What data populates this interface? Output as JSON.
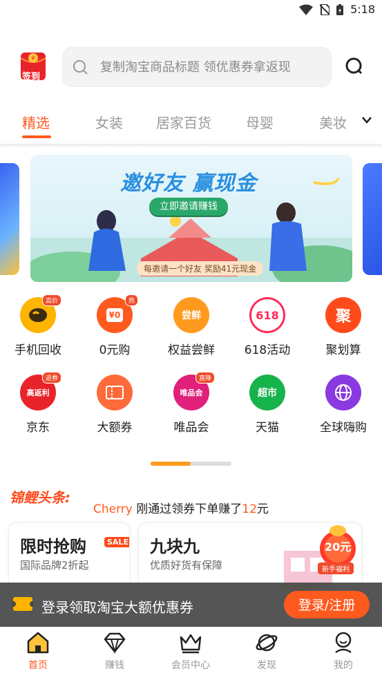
{
  "status_bar": {
    "time": "5:18"
  },
  "header": {
    "checkin_label": "签到",
    "search_placeholder": "复制淘宝商品标题 领优惠券拿返现"
  },
  "tabs": [
    "精选",
    "女装",
    "居家百货",
    "母婴",
    "美妆"
  ],
  "active_tab": "精选",
  "banner": {
    "title": "邀好友 赢现金",
    "button": "立即邀请赚钱",
    "footer": "每邀请一个好友 奖励41元现金"
  },
  "grid": [
    {
      "label": "手机回收",
      "badge": "高价",
      "icon_text": "",
      "color": "#ffb400",
      "icon": "phone-recycle-icon"
    },
    {
      "label": "0元购",
      "badge": "热",
      "icon_text": "¥0",
      "color": "#ff5a1e",
      "icon": "zero-buy-icon"
    },
    {
      "label": "权益尝鲜",
      "badge": "",
      "icon_text": "尝鲜",
      "color": "#ff9a1e",
      "icon": "benefit-try-icon"
    },
    {
      "label": "618活动",
      "badge": "",
      "icon_text": "618",
      "color": "#ff2a5a",
      "icon": "event-618-icon"
    },
    {
      "label": "聚划算",
      "badge": "",
      "icon_text": "聚",
      "color": "#ff4a1a",
      "icon": "juhuasuan-icon"
    },
    {
      "label": "京东",
      "badge": "返券",
      "icon_text": "高返利",
      "color": "#e8232a",
      "icon": "jd-icon"
    },
    {
      "label": "大额券",
      "badge": "",
      "icon_text": "券",
      "color": "#ff6a3a",
      "icon": "big-coupon-icon"
    },
    {
      "label": "唯品会",
      "badge": "直降",
      "icon_text": "唯品会",
      "color": "#e0207a",
      "icon": "vip-icon"
    },
    {
      "label": "天猫",
      "badge": "",
      "icon_text": "超市",
      "color": "#16b34a",
      "icon": "tmall-icon"
    },
    {
      "label": "全球嗨购",
      "badge": "",
      "icon_text": "",
      "color": "#8a3ae0",
      "icon": "global-shop-icon"
    }
  ],
  "headline": {
    "logo": "锦鲤头条:",
    "user": "Cherry",
    "text_before": " 刚通过领券下单赚了",
    "amount": "12",
    "unit": "元"
  },
  "cards": [
    {
      "title": "限时抢购",
      "tag": "SALE",
      "subtitle": "国际品牌2折起"
    },
    {
      "title": "九块九",
      "subtitle": "优质好货有保障"
    }
  ],
  "promo": {
    "amount": "20元",
    "ribbon": "新手福利"
  },
  "login_bar": {
    "text": "登录领取淘宝大额优惠券",
    "button": "登录/注册"
  },
  "tabbar": [
    {
      "label": "首页",
      "icon": "home-icon"
    },
    {
      "label": "赚钱",
      "icon": "diamond-icon"
    },
    {
      "label": "会员中心",
      "icon": "crown-icon"
    },
    {
      "label": "发现",
      "icon": "planet-icon"
    },
    {
      "label": "我的",
      "icon": "profile-icon"
    }
  ],
  "colors": {
    "accent": "#ff5a1e",
    "pager": "#ff9b1e"
  }
}
